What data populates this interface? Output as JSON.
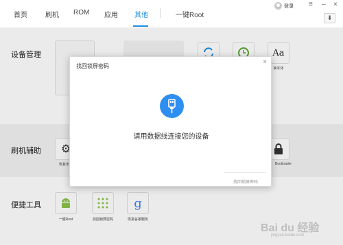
{
  "nav": {
    "tabs": [
      {
        "label": "首页"
      },
      {
        "label": "刷机"
      },
      {
        "label": "ROM"
      },
      {
        "label": "应用"
      },
      {
        "label": "其他"
      },
      {
        "label": "一键Root"
      }
    ],
    "active_tab": "其他",
    "login_label": "登录",
    "menu_icon": "hamburger-icon",
    "minimize_icon": "minimize-icon",
    "close_icon": "close-icon",
    "download_icon": "download-icon"
  },
  "sections": [
    {
      "title": "设备管理",
      "tiles": [
        {
          "label": "",
          "icon": "sync-icon"
        },
        {
          "label": "",
          "icon": "clock-restore-icon"
        },
        {
          "label": "换字体",
          "icon": "font-icon"
        }
      ]
    },
    {
      "title": "刷机辅助",
      "tiles": [
        {
          "label": "恢复出厂",
          "icon": "gear-icon"
        },
        {
          "label": "Bootloader",
          "icon": "lock-icon"
        }
      ]
    },
    {
      "title": "便捷工具",
      "tiles": [
        {
          "label": "一键Root",
          "icon": "android-icon"
        },
        {
          "label": "找回锁屏密码",
          "icon": "pattern-lock-icon"
        },
        {
          "label": "恢复谷歌服务",
          "icon": "google-icon"
        }
      ]
    }
  ],
  "modal": {
    "title": "找回锁屏密码",
    "close_symbol": "×",
    "icon": "usb-cable-icon",
    "message": "请用数据线连接您的设备",
    "button_label": "找回锁屏密码"
  },
  "colors": {
    "accent": "#1e8fe1",
    "usb_circle": "#2f8ff0",
    "android_green": "#8bc34a",
    "google_blue": "#4285f4"
  },
  "watermark": {
    "text": "Bai du 经验",
    "sub": "jingyan.baidu.com"
  }
}
